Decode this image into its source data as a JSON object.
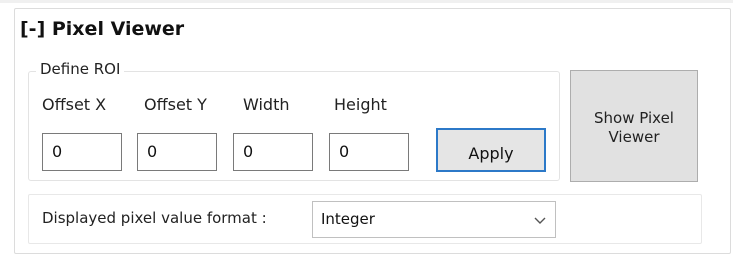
{
  "panel": {
    "title": "[-] Pixel Viewer"
  },
  "roi": {
    "group_label": "Define ROI",
    "fields": [
      {
        "label": "Offset X",
        "value": "0"
      },
      {
        "label": "Offset Y",
        "value": "0"
      },
      {
        "label": "Width",
        "value": "0"
      },
      {
        "label": "Height",
        "value": "0"
      }
    ],
    "apply_label": "Apply"
  },
  "show_button": {
    "line1": "Show Pixel",
    "line2": "Viewer"
  },
  "format": {
    "label": "Displayed pixel value format :",
    "selected": "Integer",
    "chevron_icon": "chevron-down-icon"
  },
  "colors": {
    "apply_border": "#2c79c8",
    "button_bg": "#e1e1e1"
  }
}
